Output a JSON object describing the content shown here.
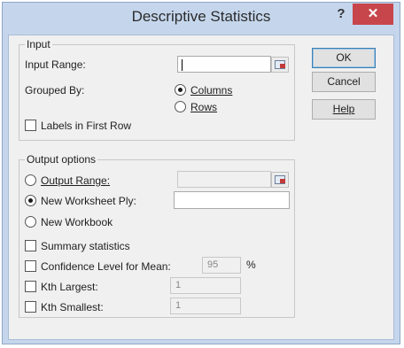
{
  "window": {
    "title": "Descriptive Statistics",
    "help_glyph": "?",
    "close_glyph": "✕"
  },
  "input_group": {
    "legend": "Input",
    "input_range_label": "Input Range:",
    "grouped_by_label": "Grouped By:",
    "options": [
      "Columns",
      "Rows"
    ],
    "selected": "Columns",
    "labels_first_row": {
      "label": "Labels in First Row",
      "checked": false
    }
  },
  "output_group": {
    "legend": "Output options",
    "destinations": [
      "Output Range:",
      "New Worksheet Ply:",
      "New Workbook"
    ],
    "selected": "New Worksheet Ply:",
    "summary_statistics": {
      "label": "Summary statistics",
      "checked": false
    },
    "confidence_level": {
      "label": "Confidence Level for Mean:",
      "value": "95",
      "unit": "%",
      "checked": false
    },
    "kth_largest": {
      "label": "Kth Largest:",
      "value": "1",
      "checked": false
    },
    "kth_smallest": {
      "label": "Kth Smallest:",
      "value": "1",
      "checked": false
    }
  },
  "buttons": {
    "ok": "OK",
    "cancel": "Cancel",
    "help": "Help"
  },
  "colors": {
    "frame": "#c5d6ec",
    "close": "#c7464c",
    "client": "#f0f0f0"
  }
}
